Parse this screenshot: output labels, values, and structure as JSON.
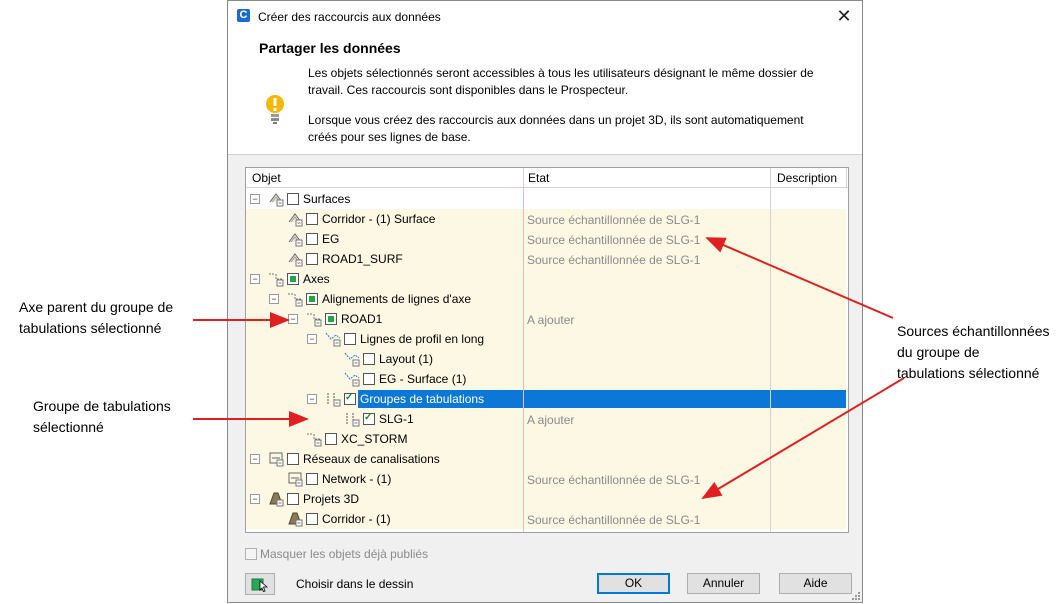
{
  "annotations": {
    "left_top": [
      "Axe parent du groupe de",
      "tabulations sélectionné"
    ],
    "left_bottom": [
      "Groupe de tabulations",
      "sélectionné"
    ],
    "right": [
      "Sources échantillonnées",
      "du groupe de",
      "tabulations sélectionné"
    ]
  },
  "dialog": {
    "title": "Créer des raccourcis aux données",
    "app_icon_letter": "C",
    "close_glyph": "✕",
    "section_title": "Partager les données",
    "paragraph1": "Les objets sélectionnés seront accessibles à tous les utilisateurs désignant le même dossier de travail. Ces raccourcis sont disponibles dans le Prospecteur.",
    "paragraph2": "Lorsque vous créez des raccourcis aux données dans un projet 3D, ils sont automatiquement créés pour ses lignes de base.",
    "columns": {
      "object": "Objet",
      "state": "Etat",
      "description": "Description"
    },
    "tree": [
      {
        "label": "Surfaces",
        "state": "",
        "checkbox": "unchecked",
        "icon": "surface-folder-icon",
        "expanded": true
      },
      {
        "label": "Corridor - (1) Surface",
        "state": "Source échantillonnée de SLG-1",
        "checkbox": "unchecked",
        "icon": "surface-icon"
      },
      {
        "label": "EG",
        "state": "Source échantillonnée de SLG-1",
        "checkbox": "unchecked",
        "icon": "surface-icon"
      },
      {
        "label": "ROAD1_SURF",
        "state": "Source échantillonnée de SLG-1",
        "checkbox": "unchecked",
        "icon": "surface-icon"
      },
      {
        "label": "Axes",
        "state": "",
        "checkbox": "partial",
        "icon": "alignment-folder-icon",
        "expanded": true
      },
      {
        "label": "Alignements de lignes d'axe",
        "state": "",
        "checkbox": "partial",
        "icon": "alignment-folder-icon",
        "expanded": true
      },
      {
        "label": "ROAD1",
        "state": "A ajouter",
        "checkbox": "partial",
        "icon": "alignment-icon",
        "expanded": true
      },
      {
        "label": "Lignes de profil en long",
        "state": "",
        "checkbox": "unchecked",
        "icon": "profile-folder-icon",
        "expanded": true
      },
      {
        "label": "Layout (1)",
        "state": "",
        "checkbox": "unchecked",
        "icon": "profile-icon"
      },
      {
        "label": "EG - Surface (1)",
        "state": "",
        "checkbox": "unchecked",
        "icon": "profile-icon"
      },
      {
        "label": "Groupes de tabulations",
        "state": "",
        "checkbox": "checked",
        "icon": "sample-line-folder-icon",
        "expanded": true,
        "selected": true
      },
      {
        "label": "SLG-1",
        "state": "A ajouter",
        "checkbox": "checked",
        "icon": "sample-line-icon"
      },
      {
        "label": "XC_STORM",
        "state": "",
        "checkbox": "unchecked",
        "icon": "alignment-icon"
      },
      {
        "label": "Réseaux de canalisations",
        "state": "",
        "checkbox": "unchecked",
        "icon": "pipe-network-folder-icon",
        "expanded": true
      },
      {
        "label": "Network - (1)",
        "state": "Source échantillonnée de SLG-1",
        "checkbox": "unchecked",
        "icon": "pipe-network-icon"
      },
      {
        "label": "Projets 3D",
        "state": "",
        "checkbox": "unchecked",
        "icon": "corridor-folder-icon",
        "expanded": true
      },
      {
        "label": "Corridor - (1)",
        "state": "Source échantillonnée de SLG-1",
        "checkbox": "unchecked",
        "icon": "corridor-icon"
      }
    ],
    "hide_published_label": "Masquer les objets déjà publiés",
    "pick_from_drawing_label": "Choisir dans le dessin",
    "ok_label": "OK",
    "cancel_label": "Annuler",
    "help_label": "Aide"
  },
  "colors": {
    "selection": "#0b78d7",
    "row_fill": "#fdf8e4",
    "arrow": "#e02020",
    "column_guide": "#f2b8b8"
  }
}
